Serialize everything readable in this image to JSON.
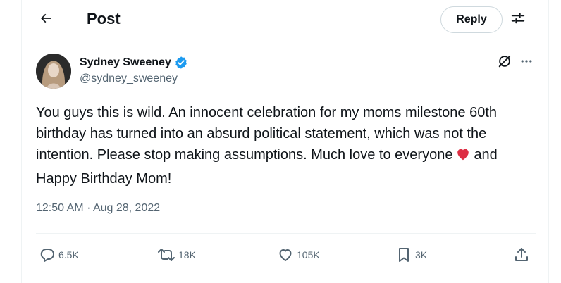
{
  "header": {
    "title": "Post",
    "reply_label": "Reply"
  },
  "author": {
    "name": "Sydney Sweeney",
    "handle": "@sydney_sweeney"
  },
  "post": {
    "text_part1": "You guys this is wild. An innocent celebration for my moms milestone 60th birthday has turned into an absurd political statement, which was not the intention. Please stop making assumptions. Much love to everyone",
    "text_part2": "and Happy Birthday Mom!",
    "time": "12:50 AM",
    "separator": "·",
    "date": "Aug 28, 2022"
  },
  "stats": {
    "replies": "6.5K",
    "reposts": "18K",
    "likes": "105K",
    "bookmarks": "3K"
  },
  "colors": {
    "verified": "#1d9bf0",
    "heart": "#dd2e44",
    "secondary_text": "#536471",
    "divider": "#eff3f4"
  },
  "icons": [
    "back-arrow-icon",
    "settings-icon",
    "verified-badge-icon",
    "grok-icon",
    "more-icon",
    "reply-icon",
    "repost-icon",
    "like-icon",
    "bookmark-icon",
    "share-icon",
    "red-heart-emoji"
  ]
}
